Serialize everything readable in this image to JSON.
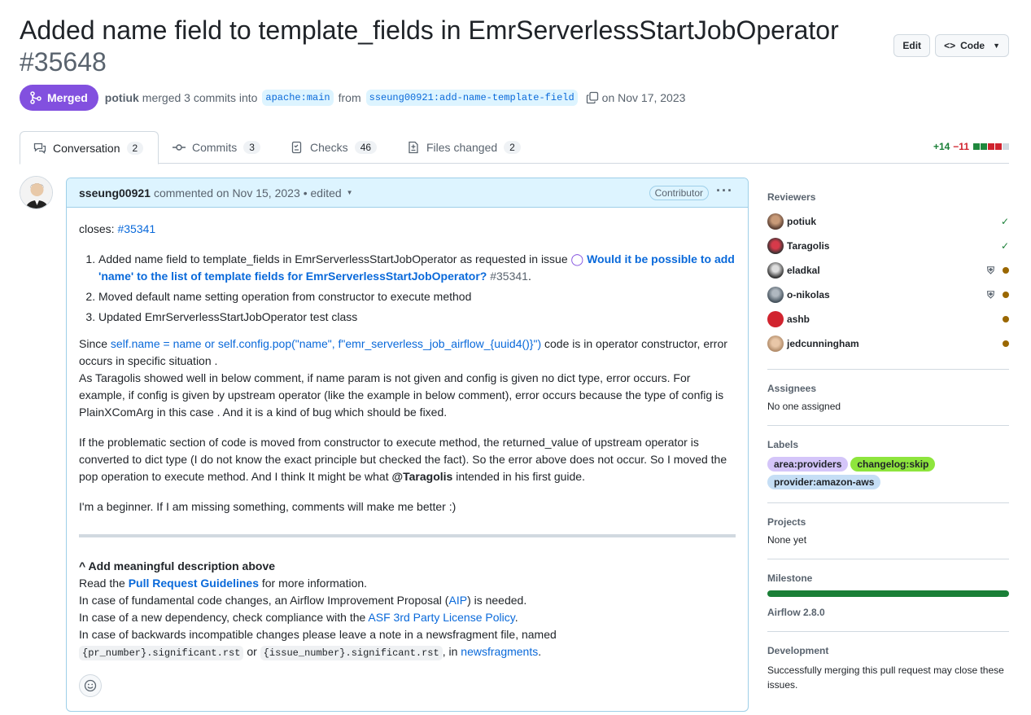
{
  "pr": {
    "title": "Added name field to template_fields in EmrServerlessStartJobOperator",
    "number": "#35648",
    "state": "Merged",
    "author": "potiuk",
    "merge_text": "merged 3 commits into",
    "base_branch": "apache:main",
    "from_text": "from",
    "head_branch": "sseung00921:add-name-template-field",
    "date_text": "on Nov 17, 2023"
  },
  "header_buttons": {
    "edit": "Edit",
    "code": "Code"
  },
  "tabs": [
    {
      "label": "Conversation",
      "count": "2"
    },
    {
      "label": "Commits",
      "count": "3"
    },
    {
      "label": "Checks",
      "count": "46"
    },
    {
      "label": "Files changed",
      "count": "2"
    }
  ],
  "diffstat": {
    "additions": "+14",
    "deletions": "−11"
  },
  "comment": {
    "author": "sseung00921",
    "meta": "commented on Nov 15, 2023",
    "edited": "• edited",
    "badge": "Contributor",
    "closes_label": "closes:",
    "closes_link": "#35341",
    "items": [
      {
        "pre": "Added name field to template_fields in EmrServerlessStartJobOperator as requested in issue",
        "link": "Would it be possible to add 'name' to the list of template fields for EmrServerlessStartJobOperator?",
        "ref": "#35341",
        "post": "."
      },
      {
        "text": "Moved default name setting operation from constructor to execute method"
      },
      {
        "text": "Updated EmrServerlessStartJobOperator test class"
      }
    ],
    "p1_pre": "Since",
    "p1_link": "self.name = name or self.config.pop(\"name\", f\"emr_serverless_job_airflow_{uuid4()}\")",
    "p1_post": "code is in operator constructor, error occurs in specific situation .",
    "p1_rest": "As Taragolis showed well in below comment, if name param is not given and config is given no dict type, error occurs. For example, if config is given by upstream operator (like the example in below comment), error occurs because the type of config is PlainXComArg in this case . And it is a kind of bug which should be fixed.",
    "p2_pre": "If the problematic section of code is moved from constructor to execute method, the returned_value of upstream operator is converted to dict type (I do not know the exact principle but checked the fact). So the error above does not occur. So I moved the pop operation to execute method. And I think It might be what",
    "p2_mention": "@Taragolis",
    "p2_post": "intended in his first guide.",
    "p3": "I'm a beginner. If I am missing something, comments will make me better :)",
    "footer_heading": "^ Add meaningful description above",
    "f1_pre": "Read the",
    "f1_link": "Pull Request Guidelines",
    "f1_post": "for more information.",
    "f2_pre": "In case of fundamental code changes, an Airflow Improvement Proposal (",
    "f2_link": "AIP",
    "f2_post": ") is needed.",
    "f3_pre": "In case of a new dependency, check compliance with the",
    "f3_link": "ASF 3rd Party License Policy",
    "f3_post": ".",
    "f4": "In case of backwards incompatible changes please leave a note in a newsfragment file, named",
    "f5_code1": "{pr_number}.significant.rst",
    "f5_or": "or",
    "f5_code2": "{issue_number}.significant.rst",
    "f5_in": ", in",
    "f5_link": "newsfragments",
    "f5_post": "."
  },
  "sidebar": {
    "reviewers_heading": "Reviewers",
    "reviewers": [
      {
        "name": "potiuk",
        "status": "approved"
      },
      {
        "name": "Taragolis",
        "status": "approved"
      },
      {
        "name": "eladkal",
        "status": "pending-codeowner"
      },
      {
        "name": "o-nikolas",
        "status": "pending-codeowner"
      },
      {
        "name": "ashb",
        "status": "pending"
      },
      {
        "name": "jedcunningham",
        "status": "pending"
      }
    ],
    "assignees_heading": "Assignees",
    "assignees_value": "No one assigned",
    "labels_heading": "Labels",
    "labels": [
      {
        "name": "area:providers",
        "color": "#d4c5f9"
      },
      {
        "name": "changelog:skip",
        "color": "#8ee53d"
      },
      {
        "name": "provider:amazon-aws",
        "color": "#c5def5"
      }
    ],
    "projects_heading": "Projects",
    "projects_value": "None yet",
    "milestone_heading": "Milestone",
    "milestone_progress": 1.0,
    "milestone_name": "Airflow 2.8.0",
    "development_heading": "Development",
    "development_text": "Successfully merging this pull request may close these issues."
  }
}
